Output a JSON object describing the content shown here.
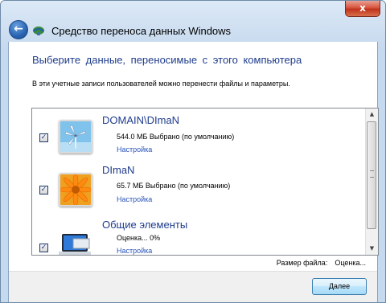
{
  "window": {
    "title": "Средство переноса данных Windows",
    "close_glyph": "x",
    "back_glyph": "←"
  },
  "main": {
    "heading": "Выберите данные, переносимые с этого компьютера",
    "description": "В эти учетные записи пользователей можно перенести файлы и параметры."
  },
  "items": [
    {
      "title": "DOMAIN\\DImaN",
      "size": "544.0 МБ Выбрано (по умолчанию)",
      "link": "Настройка",
      "checked": "✓",
      "icon": "windmill-avatar-icon"
    },
    {
      "title": "DImaN",
      "size": "65.7 МБ Выбрано (по умолчанию)",
      "link": "Настройка",
      "checked": "✓",
      "icon": "flower-avatar-icon"
    },
    {
      "title": "Общие элементы",
      "size": "Оценка... 0%",
      "link": "Настройка",
      "checked": "✓",
      "icon": "computer-icon"
    }
  ],
  "footer": {
    "file_size_label": "Размер файла:",
    "file_size_value": "Оценка..."
  },
  "buttons": {
    "next": "Далее"
  },
  "colors": {
    "heading": "#1e3c8c",
    "link": "#2a54b8",
    "window_frame": "#c5d9ef",
    "close_button": "#c0321c"
  }
}
